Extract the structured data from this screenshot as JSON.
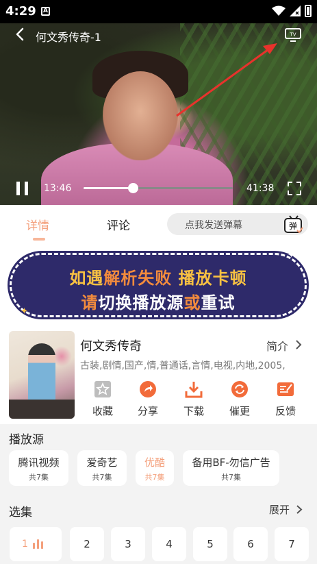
{
  "status_bar": {
    "time": "4:29",
    "a_icon": "A"
  },
  "player": {
    "title": "何文秀传奇-1",
    "current_time": "13:46",
    "total_time": "41:38",
    "progress": 0.33
  },
  "tabs": {
    "detail": "详情",
    "comment": "评论"
  },
  "danmaku": {
    "placeholder": "点我发送弹幕",
    "icon_label": "弹"
  },
  "banner": {
    "line1": [
      "如遇",
      "解析失败",
      " 播放卡顿"
    ],
    "line2": [
      "请",
      "切换播放源",
      "或",
      "重试"
    ]
  },
  "show": {
    "title": "何文秀传奇",
    "intro_label": "简介",
    "tags": "古装,剧情,国产,情,普通话,言情,电视,内地,2005,",
    "actions": [
      {
        "label": "收藏",
        "icon": "star-icon"
      },
      {
        "label": "分享",
        "icon": "share-icon"
      },
      {
        "label": "下载",
        "icon": "download-icon"
      },
      {
        "label": "催更",
        "icon": "refresh-icon"
      },
      {
        "label": "反馈",
        "icon": "feedback-icon"
      }
    ]
  },
  "sources": {
    "title": "播放源",
    "items": [
      {
        "name": "腾讯视频",
        "count": "共7集"
      },
      {
        "name": "爱奇艺",
        "count": "共7集"
      },
      {
        "name": "优酷",
        "count": "共7集"
      },
      {
        "name": "备用BF-勿信广告",
        "count": "共7集"
      }
    ],
    "active_index": 2
  },
  "episodes": {
    "title": "选集",
    "expand_label": "展开",
    "items": [
      "1",
      "2",
      "3",
      "4",
      "5",
      "6",
      "7"
    ]
  },
  "colors": {
    "accent": "#f4a07c",
    "banner_bg": "#2e2a6a",
    "banner_yellow": "#f8c142",
    "banner_orange": "#f28b3d",
    "arrow": "#e8322c"
  }
}
